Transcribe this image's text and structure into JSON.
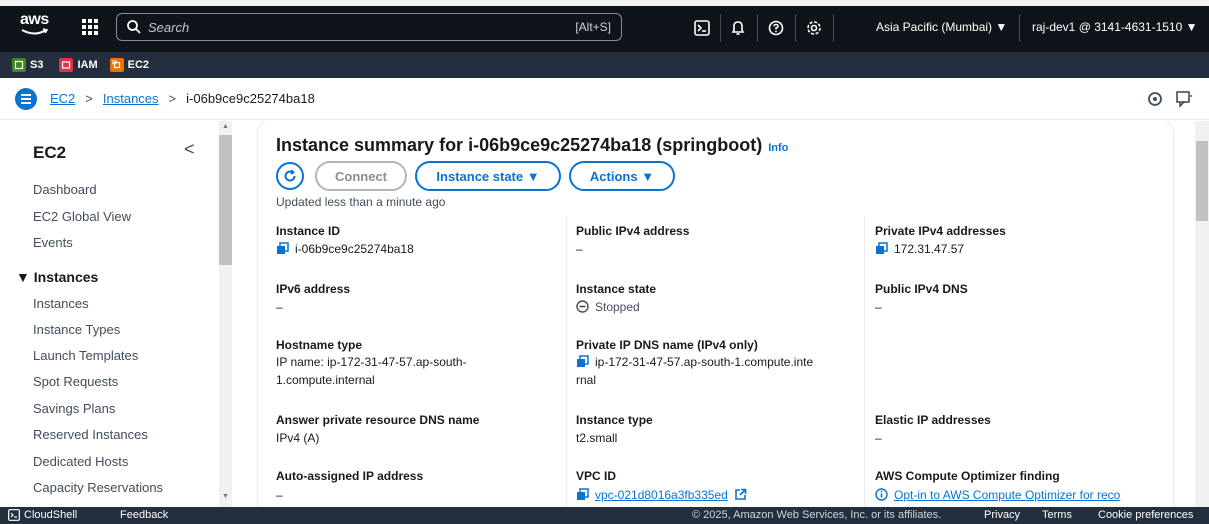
{
  "topnav": {
    "logo_text": "aws",
    "search_placeholder": "Search",
    "search_shortcut": "[Alt+S]",
    "region": "Asia Pacific (Mumbai) ▼",
    "account": "raj-dev1 @ 3141-4631-1510 ▼"
  },
  "favorites": [
    {
      "label": "S3",
      "color": "#3f8624"
    },
    {
      "label": "IAM",
      "color": "#dd344c"
    },
    {
      "label": "EC2",
      "color": "#ed7100"
    }
  ],
  "breadcrumb": {
    "items": [
      "EC2",
      "Instances"
    ],
    "current": "i-06b9ce9c25274ba18",
    "separator": ">"
  },
  "sidebar": {
    "title": "EC2",
    "close_glyph": "<",
    "top_items": [
      "Dashboard",
      "EC2 Global View",
      "Events"
    ],
    "section": "▼ Instances",
    "section_items": [
      "Instances",
      "Instance Types",
      "Launch Templates",
      "Spot Requests",
      "Savings Plans",
      "Reserved Instances",
      "Dedicated Hosts",
      "Capacity Reservations"
    ]
  },
  "summary": {
    "title": "Instance summary for i-06b9ce9c25274ba18 (springboot)",
    "info_label": "Info",
    "connect_label": "Connect",
    "instance_state_label": "Instance state ▼",
    "actions_label": "Actions ▼",
    "updated_text": "Updated less than a minute ago"
  },
  "fields": {
    "instance_id": {
      "label": "Instance ID",
      "value": "i-06b9ce9c25274ba18"
    },
    "public_ipv4": {
      "label": "Public IPv4 address",
      "value": "–"
    },
    "private_ipv4": {
      "label": "Private IPv4 addresses",
      "value": "172.31.47.57"
    },
    "ipv6": {
      "label": "IPv6 address",
      "value": "–"
    },
    "instance_state": {
      "label": "Instance state",
      "value": "Stopped"
    },
    "public_dns": {
      "label": "Public IPv4 DNS",
      "value": "–"
    },
    "hostname_type": {
      "label": "Hostname type",
      "value_line1": "IP name: ip-172-31-47-57.ap-south-",
      "value_line2": "1.compute.internal"
    },
    "private_dns": {
      "label": "Private IP DNS name (IPv4 only)",
      "value_line1": "ip-172-31-47-57.ap-south-1.compute.inte",
      "value_line2": "rnal"
    },
    "answer_dns": {
      "label": "Answer private resource DNS name",
      "value": "IPv4 (A)"
    },
    "instance_type": {
      "label": "Instance type",
      "value": "t2.small"
    },
    "elastic_ip": {
      "label": "Elastic IP addresses",
      "value": "–"
    },
    "auto_ip": {
      "label": "Auto-assigned IP address",
      "value": "–"
    },
    "vpc_id": {
      "label": "VPC ID",
      "value": "vpc-021d8016a3fb335ed"
    },
    "optimizer": {
      "label": "AWS Compute Optimizer finding",
      "value": "Opt-in to AWS Compute Optimizer for reco"
    }
  },
  "footer": {
    "cloudshell": "CloudShell",
    "feedback": "Feedback",
    "copyright": "© 2025, Amazon Web Services, Inc. or its affiliates.",
    "privacy": "Privacy",
    "terms": "Terms",
    "cookie": "Cookie preferences"
  },
  "colors": {
    "nav_bg": "#0f141a",
    "fav_bg": "#232f3e",
    "link": "#0972d3"
  }
}
